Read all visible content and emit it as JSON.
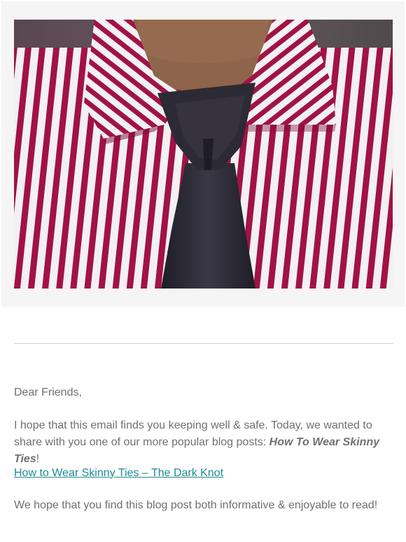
{
  "hero": {
    "image_alt": "Red and white striped dress shirt with a dark knotted skinny tie",
    "colors": {
      "panel_bg": "#f5f5f5",
      "stripe_red": "#a11245",
      "stripe_white": "#f3f0f2",
      "tie": "#2c2a34",
      "skin": "#8e644a"
    }
  },
  "email": {
    "greeting": "Dear Friends,",
    "intro_before": "I hope that this email finds you keeping well & safe.  Today, we wanted to share with you one of our more popular blog posts: ",
    "intro_emphasis": "How To Wear Skinny Ties",
    "intro_after": "!",
    "link_text": "How to Wear Skinny Ties – The Dark Knot",
    "closing": "We hope that you find this blog post both informative & enjoyable to read!"
  },
  "colors": {
    "text": "#707070",
    "link": "#1f8a93",
    "divider": "#cfcfcf"
  }
}
